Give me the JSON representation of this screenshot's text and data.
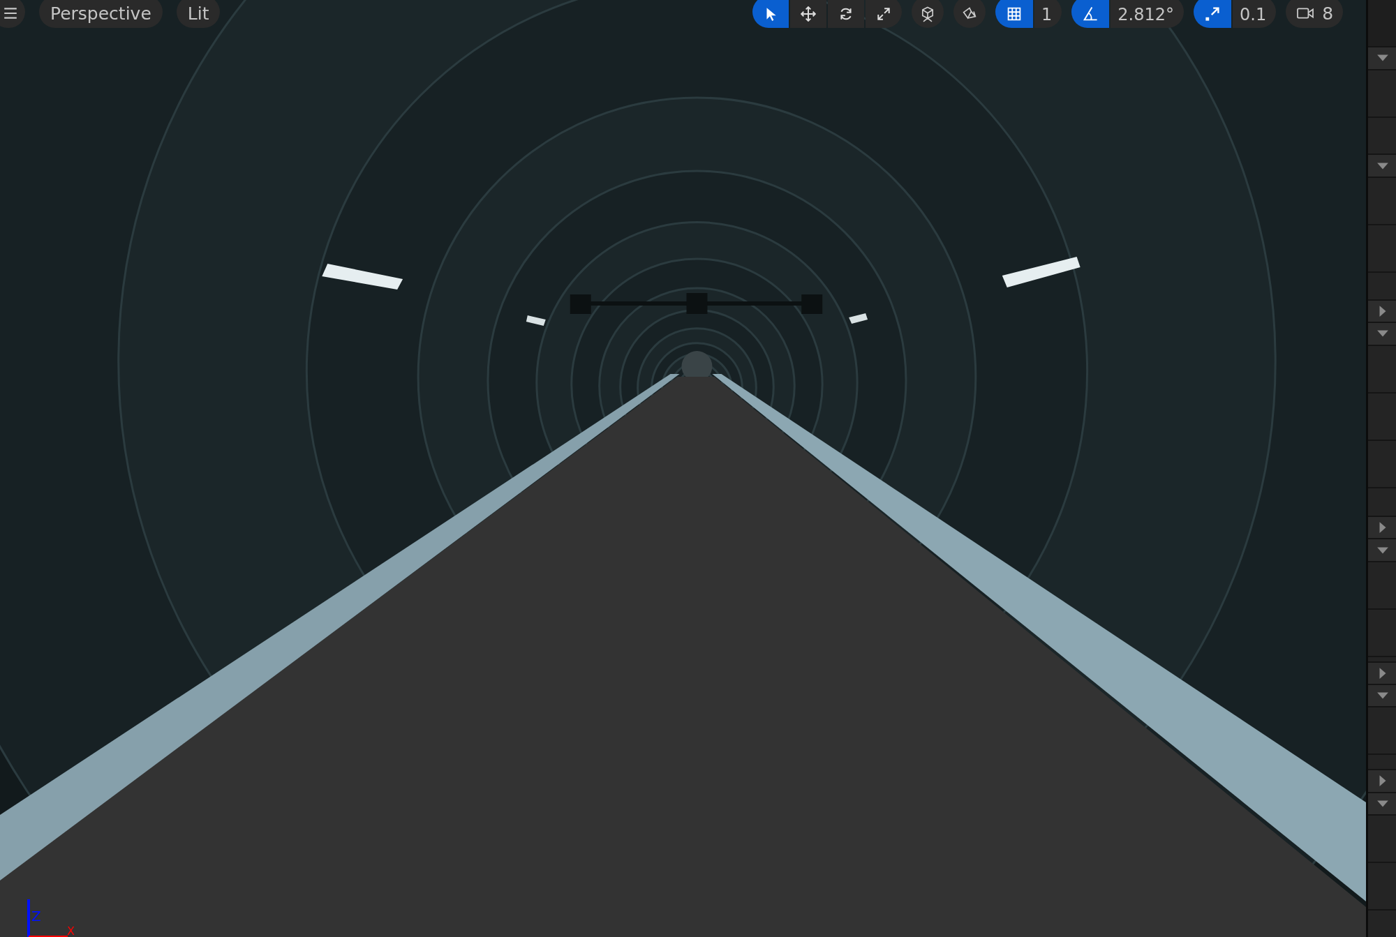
{
  "viewport": {
    "view_mode": "Perspective",
    "lighting_mode": "Lit",
    "axis_labels": [
      "Z",
      "X"
    ]
  },
  "toolbar": {
    "transform_tools": [
      {
        "kind": "select",
        "selected": true
      },
      {
        "kind": "move",
        "selected": false
      },
      {
        "kind": "rotate",
        "selected": false
      },
      {
        "kind": "scale",
        "selected": false
      }
    ],
    "grid_snap": {
      "on": true,
      "value": "1"
    },
    "rotation_snap": {
      "on": true,
      "value": "2.812°"
    },
    "scale_snap": {
      "on": true,
      "value": "0.1"
    },
    "camera_speed": "8"
  },
  "details_panel": {
    "sections": [
      {
        "expanded": true
      },
      {
        "expanded": true
      },
      {
        "expanded": false
      },
      {
        "expanded": true
      },
      {
        "expanded": false
      },
      {
        "expanded": true
      },
      {
        "expanded": false
      },
      {
        "expanded": true
      },
      {
        "expanded": false
      },
      {
        "expanded": true
      }
    ]
  }
}
